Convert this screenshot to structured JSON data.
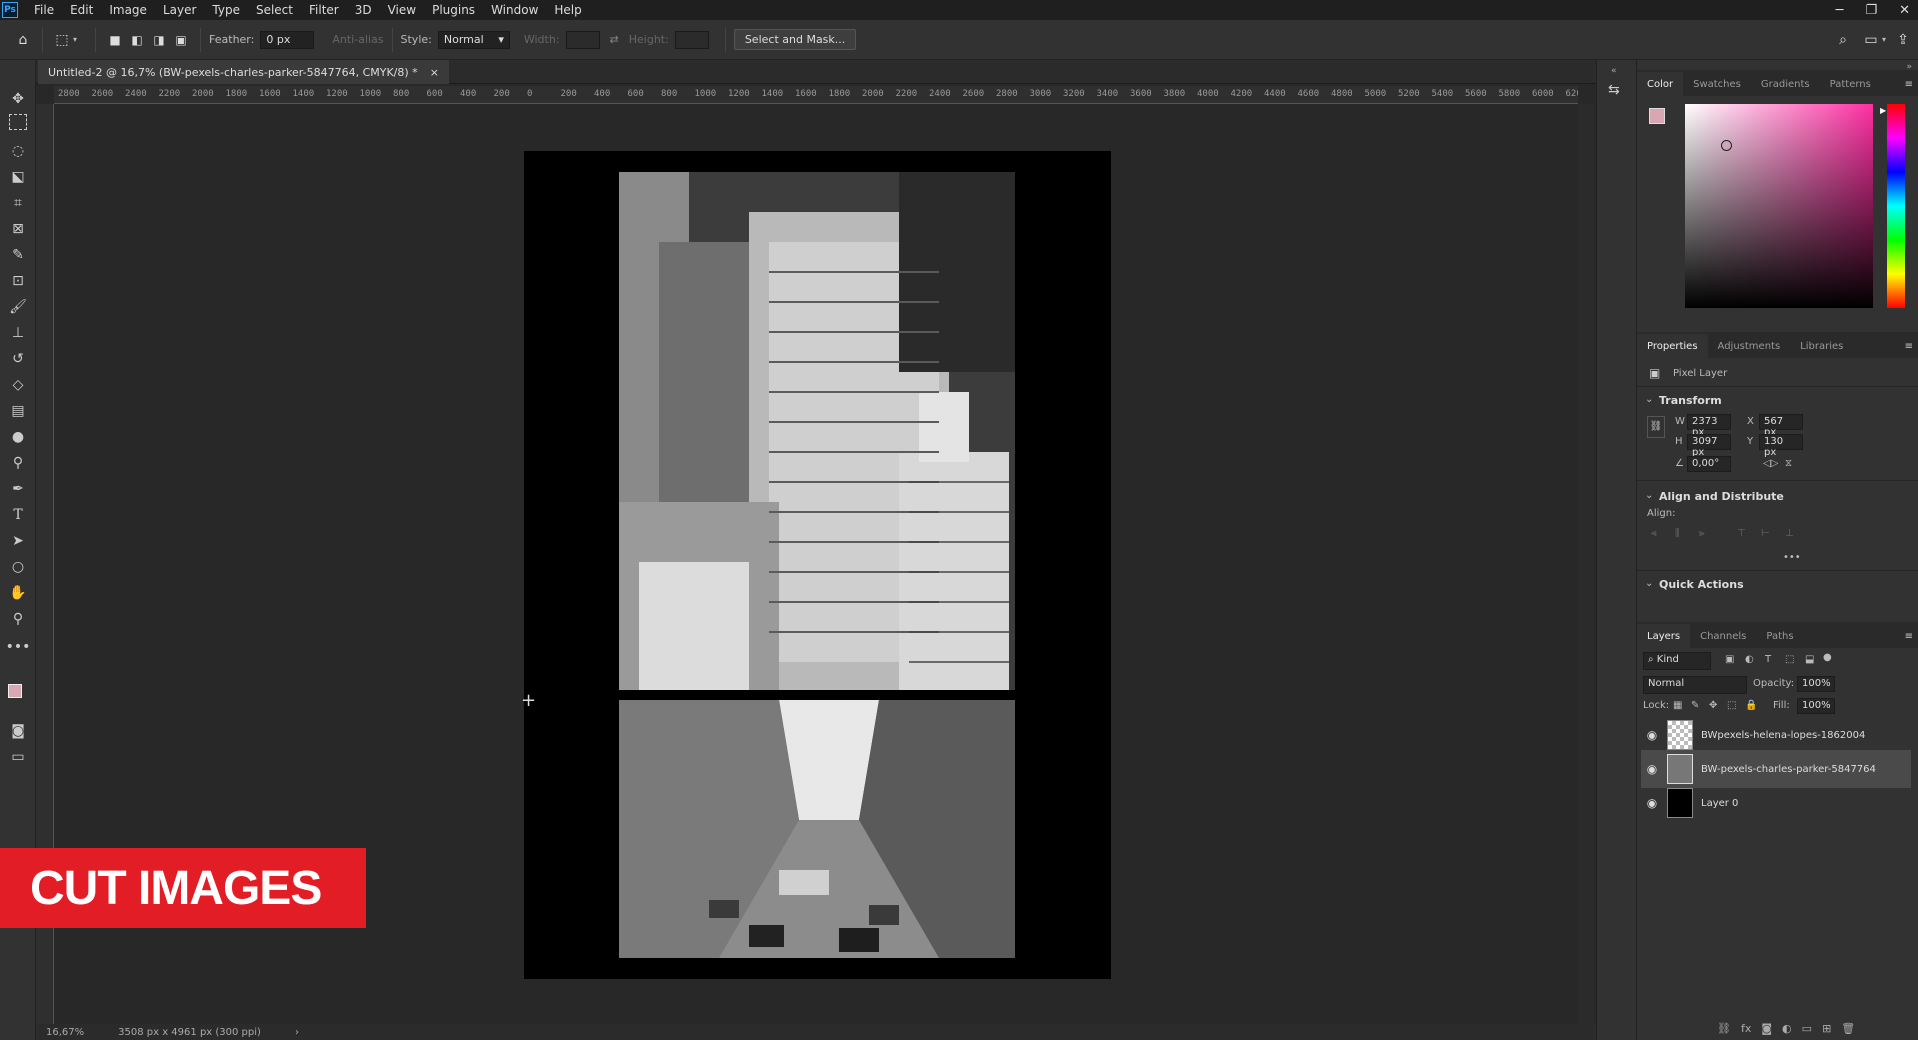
{
  "menubar": {
    "logo": "Ps",
    "items": [
      "File",
      "Edit",
      "Image",
      "Layer",
      "Type",
      "Select",
      "Filter",
      "3D",
      "View",
      "Plugins",
      "Window",
      "Help"
    ]
  },
  "options": {
    "feather_label": "Feather:",
    "feather_value": "0 px",
    "antialias_label": "Anti-alias",
    "style_label": "Style:",
    "style_value": "Normal",
    "width_label": "Width:",
    "height_label": "Height:",
    "select_mask_label": "Select and Mask..."
  },
  "document": {
    "tab_title": "Untitled-2 @ 16,7% (BW-pexels-charles-parker-5847764, CMYK/8) *",
    "close": "×"
  },
  "ruler_ticks": [
    "2800",
    "2600",
    "2400",
    "2200",
    "2000",
    "1800",
    "1600",
    "1400",
    "1200",
    "1000",
    "800",
    "600",
    "400",
    "200",
    "0",
    "200",
    "400",
    "600",
    "800",
    "1000",
    "1200",
    "1400",
    "1600",
    "1800",
    "2000",
    "2200",
    "2400",
    "2600",
    "2800",
    "3000",
    "3200",
    "3400",
    "3600",
    "3800",
    "4000",
    "4200",
    "4400",
    "4600",
    "4800",
    "5000",
    "5200",
    "5400",
    "5600",
    "5800",
    "6000",
    "620"
  ],
  "status": {
    "zoom": "16,67%",
    "doc_size": "3508 px x 4961 px (300 ppi)",
    "arrow": "›"
  },
  "overlay": {
    "label": "CUT IMAGES"
  },
  "color_panel": {
    "tabs": [
      "Color",
      "Swatches",
      "Gradients",
      "Patterns"
    ],
    "foreground": "#d9a7b1",
    "hue": "#ff2fa3"
  },
  "properties": {
    "tabs": [
      "Properties",
      "Adjustments",
      "Libraries"
    ],
    "layer_type": "Pixel Layer",
    "transform_title": "Transform",
    "w_label": "W",
    "w_value": "2373 px",
    "h_label": "H",
    "h_value": "3097 px",
    "x_label": "X",
    "x_value": "567 px",
    "y_label": "Y",
    "y_value": "130 px",
    "angle_value": "0,00°",
    "align_title": "Align and Distribute",
    "align_label": "Align:",
    "more": "•••",
    "quick_actions": "Quick Actions"
  },
  "layers": {
    "tabs": [
      "Layers",
      "Channels",
      "Paths"
    ],
    "kind_label": "Kind",
    "blend_mode": "Normal",
    "opacity_label": "Opacity:",
    "opacity_value": "100%",
    "lock_label": "Lock:",
    "fill_label": "Fill:",
    "fill_value": "100%",
    "items": [
      {
        "name": "BWpexels-helena-lopes-1862004",
        "selected": false
      },
      {
        "name": "BW-pexels-charles-parker-5847764",
        "selected": true
      },
      {
        "name": "Layer 0",
        "selected": false
      }
    ]
  }
}
